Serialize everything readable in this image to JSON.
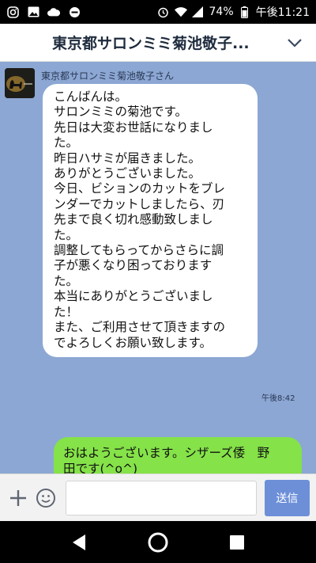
{
  "status_bar": {
    "battery": "74%",
    "clock": "午後11:21"
  },
  "header": {
    "title": "東京都サロンミミ菊池敬子..."
  },
  "conversation": {
    "incoming": {
      "sender": "東京都サロンミミ菊池敬子さん",
      "lines": [
        "こんばんは。",
        "サロンミミの菊池です。",
        "先日は大変お世話になりまし",
        "た。",
        "昨日ハサミが届きました。",
        "ありがとうございました。",
        "今日、ビションのカットをブレ",
        "ンダーでカットしましたら、刃",
        "先まで良く切れ感動致しまし",
        "た。",
        "調整してもらってからさらに調",
        "子が悪くなり困っております",
        "た。",
        "本当にありがとうございまし",
        "た！",
        "また、ご利用させて頂きますの",
        "でよろしくお願い致します。"
      ],
      "time": "午後8:42"
    },
    "outgoing": {
      "lines": [
        "おはようございます。シザーズ倭　野",
        "田です(^o^)"
      ]
    }
  },
  "input_bar": {
    "message_value": "",
    "send_label": "送信"
  },
  "icons": {
    "instagram": "instagram-icon",
    "gallery": "image-icon",
    "cloud": "cloud-icon",
    "blocked": "do-not-disturb-icon",
    "alarm": "alarm-icon",
    "wifi": "wifi-icon",
    "signal": "signal-icon",
    "battery": "battery-icon",
    "chevron": "chevron-down-icon",
    "add": "plus-icon",
    "sticker": "smiley-icon",
    "back": "back-triangle-icon",
    "home": "home-circle-icon",
    "recents": "recents-square-icon"
  },
  "colors": {
    "chat_background": "#8ca7d3",
    "incoming_bubble": "#ffffff",
    "outgoing_bubble": "#85e249",
    "send_button": "#6c8fd8"
  }
}
